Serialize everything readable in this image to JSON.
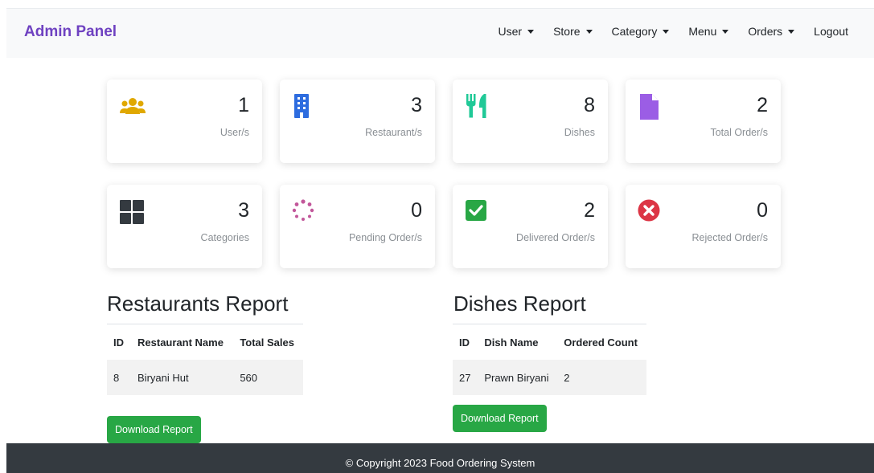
{
  "navbar": {
    "brand": "Admin Panel",
    "items": [
      {
        "label": "User",
        "dropdown": true
      },
      {
        "label": "Store",
        "dropdown": true
      },
      {
        "label": "Category",
        "dropdown": true
      },
      {
        "label": "Menu",
        "dropdown": true
      },
      {
        "label": "Orders",
        "dropdown": true
      },
      {
        "label": "Logout",
        "dropdown": false
      }
    ]
  },
  "stats": [
    {
      "value": "1",
      "label": "User/s",
      "icon": "users-icon",
      "color": "#e0a800"
    },
    {
      "value": "3",
      "label": "Restaurant/s",
      "icon": "building-icon",
      "color": "#2d6cdf"
    },
    {
      "value": "8",
      "label": "Dishes",
      "icon": "utensils-icon",
      "color": "#20c997"
    },
    {
      "value": "2",
      "label": "Total Order/s",
      "icon": "file-icon",
      "color": "#9b5de5"
    },
    {
      "value": "3",
      "label": "Categories",
      "icon": "grid-icon",
      "color": "#343a40"
    },
    {
      "value": "0",
      "label": "Pending Order/s",
      "icon": "spinner-icon",
      "color": "#c2579a"
    },
    {
      "value": "2",
      "label": "Delivered Order/s",
      "icon": "check-square-icon",
      "color": "#28a745"
    },
    {
      "value": "0",
      "label": "Rejected Order/s",
      "icon": "times-circle-icon",
      "color": "#dc3545"
    }
  ],
  "restaurants_report": {
    "title": "Restaurants Report",
    "columns": [
      "ID",
      "Restaurant Name",
      "Total Sales"
    ],
    "rows": [
      [
        "8",
        "Biryani Hut",
        "560"
      ]
    ],
    "button": "Download Report"
  },
  "dishes_report": {
    "title": "Dishes Report",
    "columns": [
      "ID",
      "Dish Name",
      "Ordered Count"
    ],
    "rows": [
      [
        "27",
        "Prawn Biryani",
        "2"
      ]
    ],
    "button": "Download Report"
  },
  "footer": {
    "text": "© Copyright 2023 Food Ordering System"
  },
  "colors": {
    "brand": "#6f42c1",
    "button": "#28a745",
    "footer_bg": "#343a40"
  }
}
